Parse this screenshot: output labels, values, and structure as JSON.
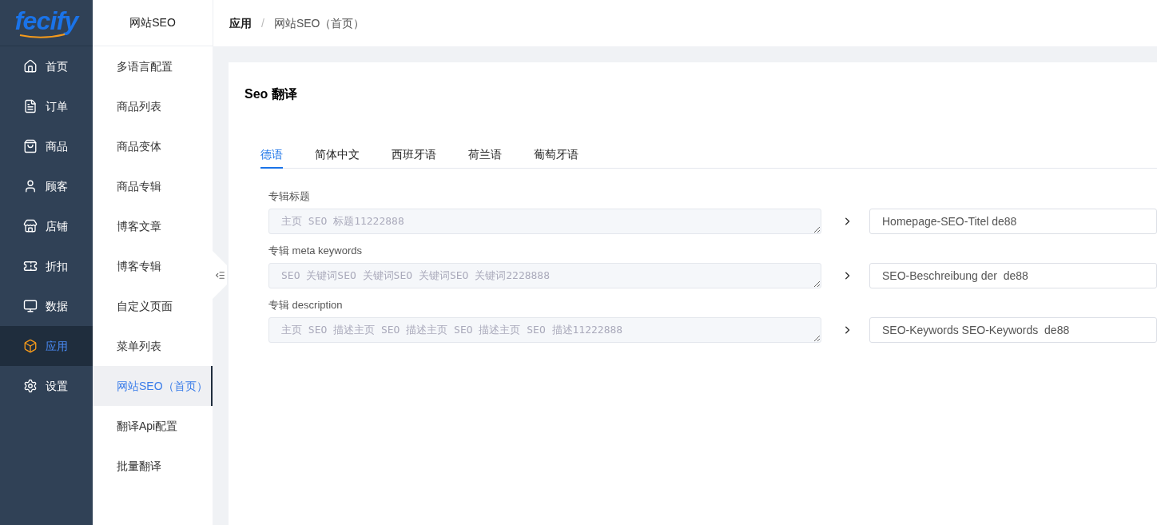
{
  "logo": {
    "text": "fecify"
  },
  "nav": [
    {
      "label": "首页",
      "selected": false
    },
    {
      "label": "订单",
      "selected": false
    },
    {
      "label": "商品",
      "selected": false
    },
    {
      "label": "顾客",
      "selected": false
    },
    {
      "label": "店铺",
      "selected": false
    },
    {
      "label": "折扣",
      "selected": false
    },
    {
      "label": "数据",
      "selected": false
    },
    {
      "label": "应用",
      "selected": true
    },
    {
      "label": "设置",
      "selected": false
    }
  ],
  "submenu": {
    "title": "网站SEO",
    "items": [
      {
        "label": "多语言配置",
        "selected": false
      },
      {
        "label": "商品列表",
        "selected": false
      },
      {
        "label": "商品变体",
        "selected": false
      },
      {
        "label": "商品专辑",
        "selected": false
      },
      {
        "label": "博客文章",
        "selected": false
      },
      {
        "label": "博客专辑",
        "selected": false
      },
      {
        "label": "自定义页面",
        "selected": false
      },
      {
        "label": "菜单列表",
        "selected": false
      },
      {
        "label": "网站SEO（首页）",
        "selected": true
      },
      {
        "label": "翻译Api配置",
        "selected": false
      },
      {
        "label": "批量翻译",
        "selected": false
      }
    ]
  },
  "breadcrumb": [
    "应用",
    "网站SEO（首页）"
  ],
  "breadcrumb_separator": "/",
  "page_title": "Seo 翻译",
  "tabs": [
    {
      "label": "德语",
      "selected": true
    },
    {
      "label": "简体中文",
      "selected": false
    },
    {
      "label": "西班牙语",
      "selected": false
    },
    {
      "label": "荷兰语",
      "selected": false
    },
    {
      "label": "葡萄牙语",
      "selected": false
    }
  ],
  "fields": [
    {
      "label": "专辑标题",
      "placeholder": "主页 SEO 标题11222888",
      "value": "Homepage-SEO-Titel de88"
    },
    {
      "label": "专辑 meta keywords",
      "placeholder": "SEO 关键词SEO 关键词SEO 关键词SEO 关键词2228888",
      "value": "SEO-Beschreibung der  de88"
    },
    {
      "label": "专辑 description",
      "placeholder": "主页 SEO 描述主页 SEO 描述主页 SEO 描述主页 SEO 描述11222888",
      "value": "SEO-Keywords SEO-Keywords  de88"
    }
  ]
}
